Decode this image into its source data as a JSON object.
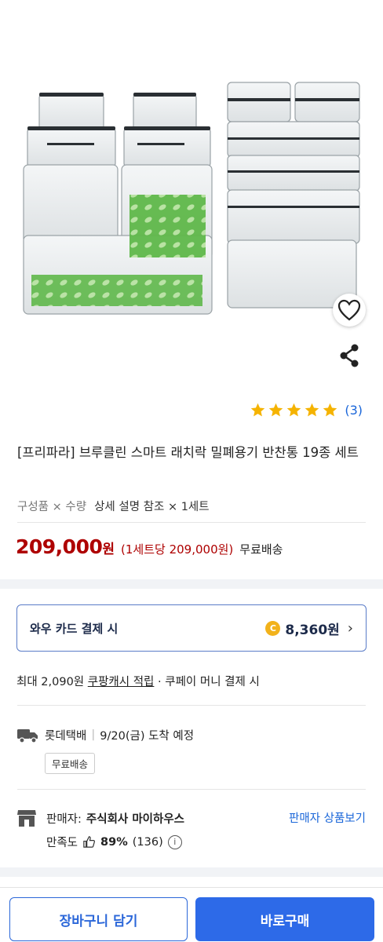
{
  "rating": {
    "stars": 5,
    "count": "(3)"
  },
  "product": {
    "title": "[프리파라] 브루클린 스마트 래치락 밀폐용기 반찬통 19종 세트",
    "option_key": "구성품 × 수량",
    "option_value": "상세 설명 참조 × 1세트"
  },
  "price": {
    "amount": "209,000",
    "won": "원",
    "unit_price": "(1세트당 209,000원)",
    "shipping": "무료배송"
  },
  "card": {
    "label": "와우 카드 결제 시",
    "coin": "C",
    "amount": "8,360원",
    "chevron": "›"
  },
  "cash": {
    "prefix": "최대 2,090원 ",
    "link": "쿠팡캐시 적립",
    "suffix": " · 쿠페이 머니 결제 시"
  },
  "delivery": {
    "carrier": "롯데택배",
    "eta": "9/20(금) 도착 예정",
    "tag": "무료배송"
  },
  "seller": {
    "label": "판매자:",
    "name": "주식회사 마이하우스",
    "link": "판매자 상품보기",
    "satisfaction_label": "만족도",
    "satisfaction_pct": "89%",
    "satisfaction_count": "(136)",
    "info": "i"
  },
  "buttons": {
    "cart": "장바구니 담기",
    "buy": "바로구매"
  },
  "colors": {
    "price": "#ae0000",
    "accent": "#2d6ae8",
    "star": "#f5b300",
    "link": "#1a66d9"
  },
  "icons": [
    "heart-icon",
    "share-icon",
    "star-icon",
    "truck-icon",
    "shop-icon",
    "thumbs-up-icon",
    "info-icon",
    "chevron-right-icon"
  ]
}
